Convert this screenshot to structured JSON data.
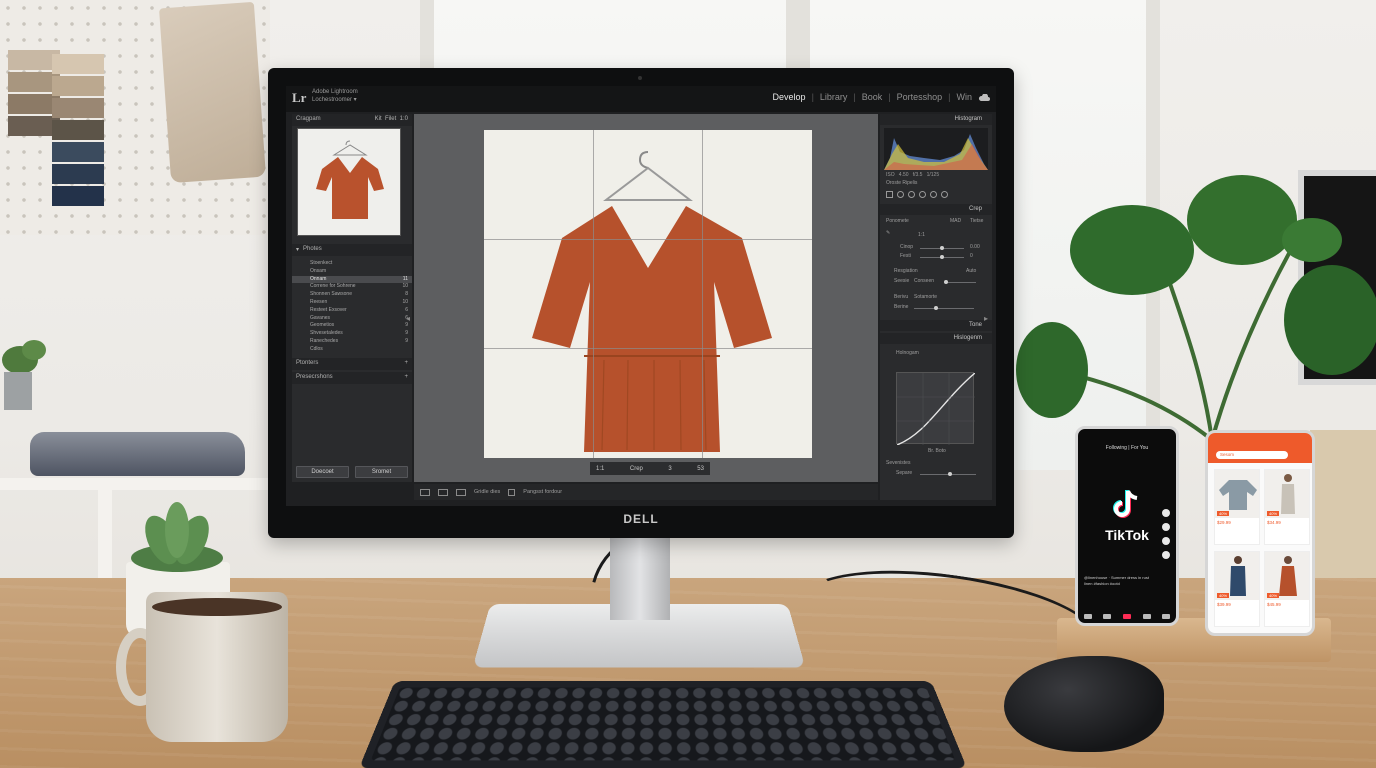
{
  "lightroom": {
    "logo": "Lr",
    "app_line1": "Adobe Lightroom",
    "app_line2": "Lochestroomer ▾",
    "modules": [
      "Develop",
      "Library",
      "Book",
      "Portesshop",
      "Win"
    ],
    "active_module": "Develop",
    "navigator": {
      "title": "Cragpam",
      "opt1": "Kit",
      "opt2": "Filet",
      "zoom": "1:0"
    },
    "collections": {
      "title": "Photes",
      "items": [
        {
          "label": "Stoenkect",
          "count": ""
        },
        {
          "label": "Onsam",
          "count": ""
        },
        {
          "label": "Onnam",
          "count": "11",
          "selected": true
        },
        {
          "label": "Correne for Sohrene",
          "count": "10"
        },
        {
          "label": "Shonnen Sawsone",
          "count": "8"
        },
        {
          "label": "Reesen",
          "count": "10"
        },
        {
          "label": "Resteet Exsover",
          "count": "6"
        },
        {
          "label": "Gavanes",
          "count": "6"
        },
        {
          "label": "Geometios",
          "count": "9"
        },
        {
          "label": "Shvesetaledes",
          "count": "9"
        },
        {
          "label": "Ranechedes",
          "count": "9"
        },
        {
          "label": "Cdlos",
          "count": ""
        }
      ],
      "extra_sections": [
        "Ptonters",
        "Presecrshons"
      ]
    },
    "left_buttons": [
      "Doecoet",
      "Sromet"
    ],
    "crop_toolbar": {
      "ratio": "1:1",
      "label": "Crep",
      "angle": "3",
      "value": "53"
    },
    "bottom_toolbar": {
      "label1": "Gridle dies",
      "label2": "Pangsst fordour"
    },
    "right_panel": {
      "histogram_title": "Histogram",
      "hist_readout": [
        "ISO",
        "4.50",
        "f/3.5",
        "1/125"
      ],
      "hist_caption": "Oroste Ripelis",
      "crop_title": "Crep",
      "crop_aspect_label": "Ponomete",
      "crop_aspect_opt1": "MAD",
      "crop_aspect_opt2": "Tietse",
      "crop_ratio": "1:1",
      "crop_row1": "Cinop",
      "crop_row1_value": "0.00",
      "crop_row2": "Festi",
      "crop_row2_value": "0",
      "straighten_label": "Resgiation",
      "straighten_opt": "Auto",
      "straighten_row": "Seesie",
      "straighten_row_value": "Conseen",
      "straighten_row2": "Berivu",
      "straighten_row2_value": "Sotamorte",
      "straighten_row3": "Berine",
      "tone_title": "Tone",
      "curve_section_title": "Hislogenm",
      "curve_label": "Holnogam",
      "curve_caption": "Br. Boto",
      "detail_label": "Sevenistes",
      "detail_label2": "Separe"
    }
  },
  "monitor_brand": "DELL",
  "tiktok": {
    "tabs": "Following | For You",
    "logo_text": "TikTok",
    "caption": "@linenhouse · Summer dress in rust linen #fashion #ootd"
  },
  "shop": {
    "search_label": "Sesom",
    "items": [
      {
        "price": "$29.99",
        "sale": "40%"
      },
      {
        "price": "$34.99",
        "sale": "40%"
      },
      {
        "price": "$39.99",
        "sale": "40%"
      },
      {
        "price": "$45.99",
        "sale": "40%"
      }
    ]
  }
}
